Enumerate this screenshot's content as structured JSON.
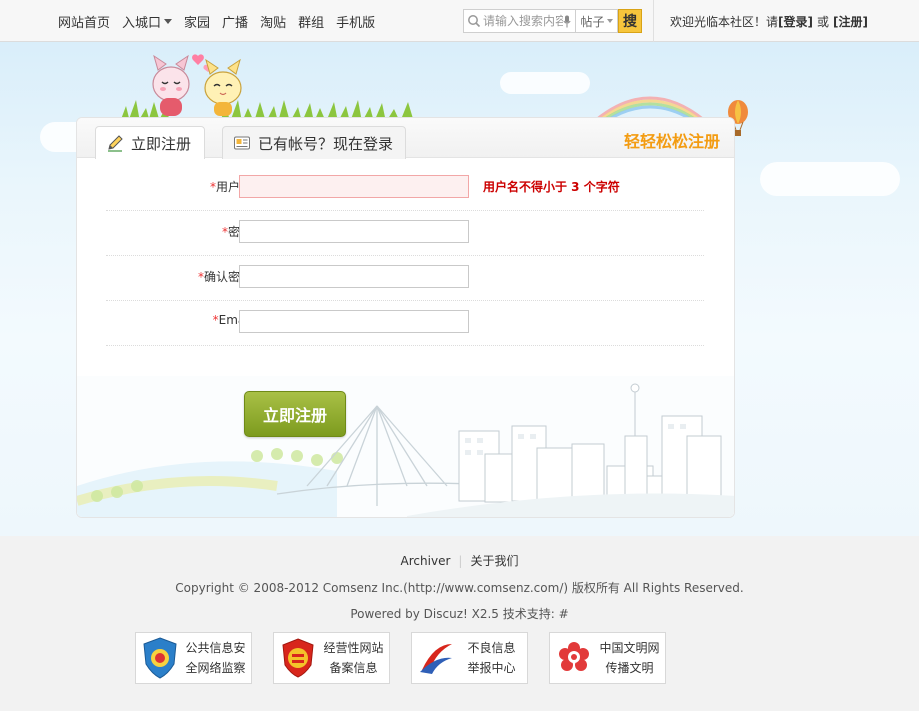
{
  "nav": {
    "items": [
      {
        "label": "网站首页"
      },
      {
        "label": "入城口",
        "dropdown": true
      },
      {
        "label": "家园"
      },
      {
        "label": "广播"
      },
      {
        "label": "淘贴"
      },
      {
        "label": "群组"
      },
      {
        "label": "手机版"
      }
    ]
  },
  "search": {
    "placeholder": "请输入搜索内容",
    "type_label": "帖子",
    "button_label": "搜"
  },
  "user_bar": {
    "welcome": "欢迎光临本社区！请",
    "login_label": "[登录]",
    "or_label": "或",
    "register_label": "[注册]"
  },
  "panel": {
    "tab_register": "立即注册",
    "tab_login": "已有帐号？现在登录",
    "slogan": "轻轻松松注册",
    "required_mark": "*",
    "fields": {
      "username": {
        "label": "用户名:",
        "error": "用户名不得小于 3 个字符"
      },
      "password": {
        "label": "密码:"
      },
      "confirm": {
        "label": "确认密码:"
      },
      "email": {
        "label": "Email:"
      }
    },
    "submit_label": "立即注册"
  },
  "footer": {
    "archiver": "Archiver",
    "separator": "|",
    "about": "关于我们",
    "copyright": "Copyright © 2008-2012 Comsenz Inc.(http://www.comsenz.com/) 版权所有 All Rights Reserved.",
    "powered": "Powered by Discuz! X2.5  技术支持: #",
    "badges": [
      {
        "line1": "公共信息安",
        "line2": "全网络监察",
        "icon": "police-shield-icon"
      },
      {
        "line1": "经营性网站",
        "line2": "备案信息",
        "icon": "business-badge-icon"
      },
      {
        "line1": "不良信息",
        "line2": "举报中心",
        "icon": "report-center-icon"
      },
      {
        "line1": "中国文明网",
        "line2": "传播文明",
        "icon": "civilization-icon"
      }
    ]
  },
  "colors": {
    "accent_orange": "#f39c12",
    "submit_green": "#8aa82b",
    "error_red": "#cc0000",
    "search_button": "#f6c53c"
  }
}
